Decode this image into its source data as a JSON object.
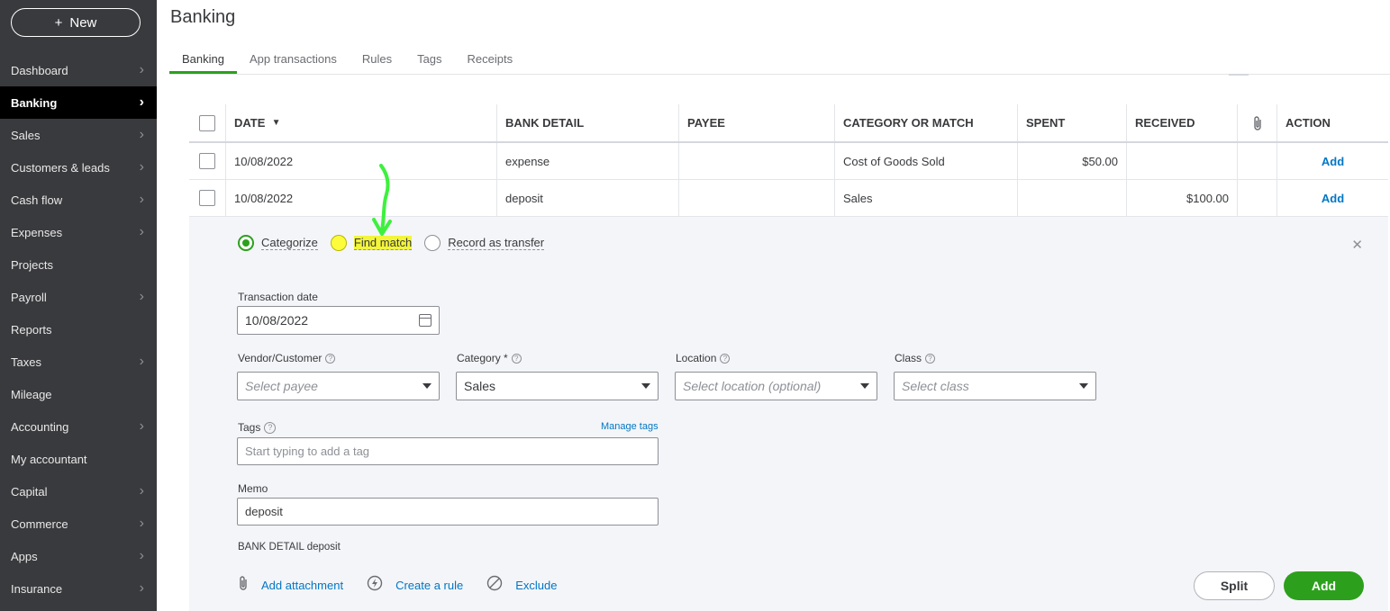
{
  "sidebar": {
    "new_label": "New",
    "items": [
      {
        "label": "Dashboard",
        "chevron": true,
        "active": false
      },
      {
        "label": "Banking",
        "chevron": true,
        "active": true
      },
      {
        "label": "Sales",
        "chevron": true,
        "active": false
      },
      {
        "label": "Customers & leads",
        "chevron": true,
        "active": false
      },
      {
        "label": "Cash flow",
        "chevron": true,
        "active": false
      },
      {
        "label": "Expenses",
        "chevron": true,
        "active": false
      },
      {
        "label": "Projects",
        "chevron": false,
        "active": false
      },
      {
        "label": "Payroll",
        "chevron": true,
        "active": false
      },
      {
        "label": "Reports",
        "chevron": false,
        "active": false
      },
      {
        "label": "Taxes",
        "chevron": true,
        "active": false
      },
      {
        "label": "Mileage",
        "chevron": false,
        "active": false
      },
      {
        "label": "Accounting",
        "chevron": true,
        "active": false
      },
      {
        "label": "My accountant",
        "chevron": false,
        "active": false
      },
      {
        "label": "Capital",
        "chevron": true,
        "active": false
      },
      {
        "label": "Commerce",
        "chevron": true,
        "active": false
      },
      {
        "label": "Apps",
        "chevron": true,
        "active": false
      },
      {
        "label": "Insurance",
        "chevron": true,
        "active": false
      }
    ]
  },
  "header": {
    "title": "Banking",
    "tabs": [
      "Banking",
      "App transactions",
      "Rules",
      "Tags",
      "Receipts"
    ],
    "active_tab": 0
  },
  "table": {
    "columns": {
      "date": "DATE",
      "bank_detail": "BANK DETAIL",
      "payee": "PAYEE",
      "category": "CATEGORY OR MATCH",
      "spent": "SPENT",
      "received": "RECEIVED",
      "action": "ACTION"
    },
    "sort_indicator": "▼",
    "rows": [
      {
        "date": "10/08/2022",
        "bank_detail": "expense",
        "payee": "",
        "category": "Cost of Goods Sold",
        "spent": "$50.00",
        "received": "",
        "action": "Add"
      },
      {
        "date": "10/08/2022",
        "bank_detail": "deposit",
        "payee": "",
        "category": "Sales",
        "spent": "",
        "received": "$100.00",
        "action": "Add"
      }
    ]
  },
  "panel": {
    "radios": {
      "categorize": "Categorize",
      "find_match": "Find match",
      "record_transfer": "Record as transfer"
    },
    "transaction_date_label": "Transaction date",
    "transaction_date_value": "10/08/2022",
    "vendor_label": "Vendor/Customer",
    "vendor_placeholder": "Select payee",
    "category_label": "Category *",
    "category_value": "Sales",
    "location_label": "Location",
    "location_placeholder": "Select location (optional)",
    "class_label": "Class",
    "class_placeholder": "Select class",
    "tags_label": "Tags",
    "manage_tags": "Manage tags",
    "tags_placeholder": "Start typing to add a tag",
    "memo_label": "Memo",
    "memo_value": "deposit",
    "bank_detail_label": "BANK DETAIL",
    "bank_detail_value": "deposit",
    "add_attachment": "Add attachment",
    "create_rule": "Create a rule",
    "exclude": "Exclude",
    "split": "Split",
    "add": "Add"
  },
  "colors": {
    "accent_green": "#2ca01c",
    "link_blue": "#0077c5",
    "sidebar_bg": "#393a3d",
    "highlight_yellow": "#f2f53a",
    "annotation_arrow": "#3ef03e"
  }
}
